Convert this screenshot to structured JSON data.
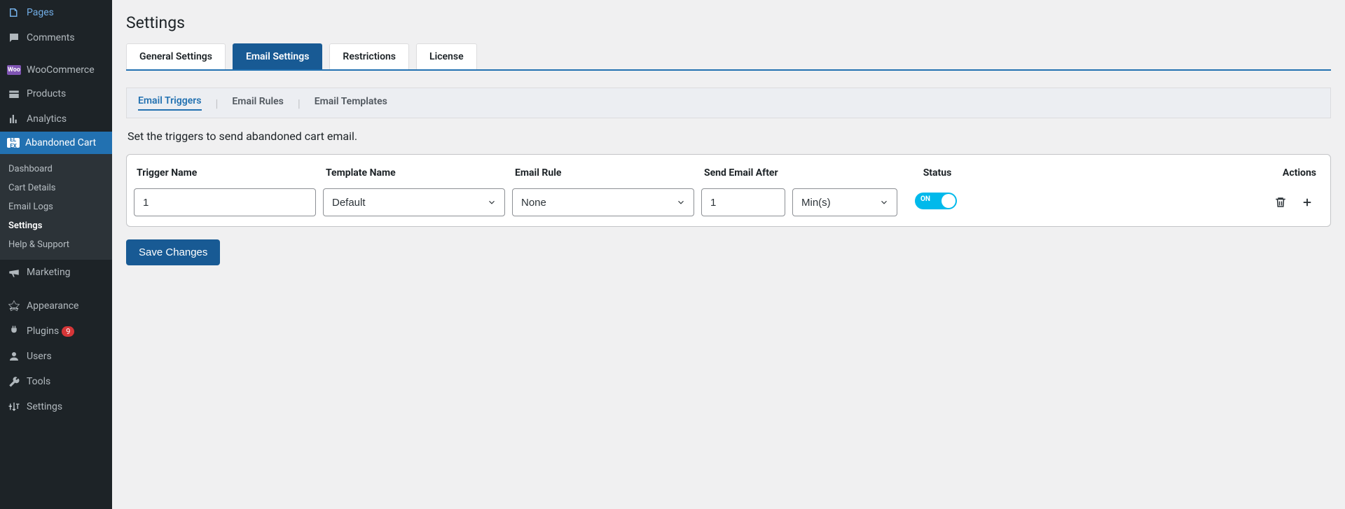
{
  "sidebar": {
    "items": [
      {
        "label": "Pages",
        "icon": "pages"
      },
      {
        "label": "Comments",
        "icon": "comments"
      },
      {
        "label": "WooCommerce",
        "icon": "woo"
      },
      {
        "label": "Products",
        "icon": "products"
      },
      {
        "label": "Analytics",
        "icon": "analytics"
      },
      {
        "label": "Abandoned Cart",
        "icon": "elex",
        "active": true
      },
      {
        "label": "Marketing",
        "icon": "marketing"
      },
      {
        "label": "Appearance",
        "icon": "appearance"
      },
      {
        "label": "Plugins",
        "icon": "plugins",
        "badge": "9"
      },
      {
        "label": "Users",
        "icon": "users"
      },
      {
        "label": "Tools",
        "icon": "tools"
      },
      {
        "label": "Settings",
        "icon": "settings"
      }
    ],
    "sub": [
      {
        "label": "Dashboard"
      },
      {
        "label": "Cart Details"
      },
      {
        "label": "Email Logs"
      },
      {
        "label": "Settings",
        "active": true
      },
      {
        "label": "Help & Support"
      }
    ]
  },
  "page": {
    "title": "Settings",
    "tabs": [
      "General Settings",
      "Email Settings",
      "Restrictions",
      "License"
    ],
    "activeTab": 1,
    "subtabs": [
      "Email Triggers",
      "Email Rules",
      "Email Templates"
    ],
    "activeSubtab": 0,
    "description": "Set the triggers to send abandoned cart email.",
    "columns": {
      "trigger": "Trigger Name",
      "template": "Template Name",
      "rule": "Email Rule",
      "sendAfter": "Send Email After",
      "status": "Status",
      "actions": "Actions"
    },
    "row": {
      "triggerName": "1",
      "templateName": "Default",
      "emailRule": "None",
      "sendAfterValue": "1",
      "sendAfterUnit": "Min(s)",
      "statusLabel": "ON"
    },
    "saveLabel": "Save Changes"
  }
}
